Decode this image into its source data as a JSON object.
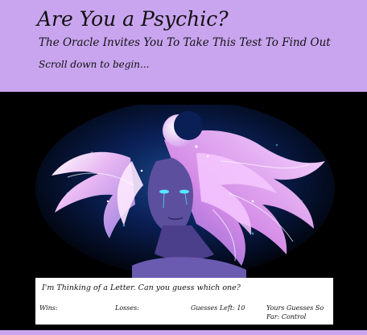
{
  "header": {
    "title": "Are You a Psychic?",
    "subtitle": "The Oracle Invites You To Take This Test To Find Out",
    "scroll_hint": "Scroll down to begin..."
  },
  "artwork": {
    "icon": "oracle-illustration",
    "colors": {
      "header_bg": "#c9a5ef",
      "stage_bg": "#000000",
      "hair": "#e7b6f2",
      "skin": "#5c4f9e",
      "eyes": "#56e7ff"
    }
  },
  "game": {
    "prompt": "I'm Thinking of a Letter. Can you guess which one?",
    "wins_label": "Wins:",
    "losses_label": "Losses:",
    "guesses_left_label": "Guesses Left: 10",
    "guesses_so_far_label": "Yours Guesses So Far: Control"
  }
}
